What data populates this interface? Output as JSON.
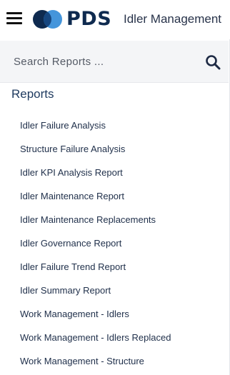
{
  "header": {
    "menu_icon": "hamburger-menu-icon",
    "logo_text": "PDS",
    "logo_colors": {
      "dark": "#0e2a4f",
      "light": "#3a8fd9"
    },
    "app_title": "Idler Management"
  },
  "search": {
    "placeholder": "Search Reports ...",
    "value": "",
    "icon": "search-icon"
  },
  "reports": {
    "heading": "Reports",
    "items": [
      {
        "label": "Idler Failure Analysis"
      },
      {
        "label": "Structure Failure Analysis"
      },
      {
        "label": "Idler KPI Analysis Report"
      },
      {
        "label": "Idler Maintenance Report"
      },
      {
        "label": "Idler Maintenance Replacements"
      },
      {
        "label": "Idler Governance Report"
      },
      {
        "label": "Idler Failure Trend Report"
      },
      {
        "label": "Idler Summary Report"
      },
      {
        "label": "Work Management - Idlers"
      },
      {
        "label": "Work Management - Idlers Replaced"
      },
      {
        "label": "Work Management - Structure"
      }
    ]
  }
}
